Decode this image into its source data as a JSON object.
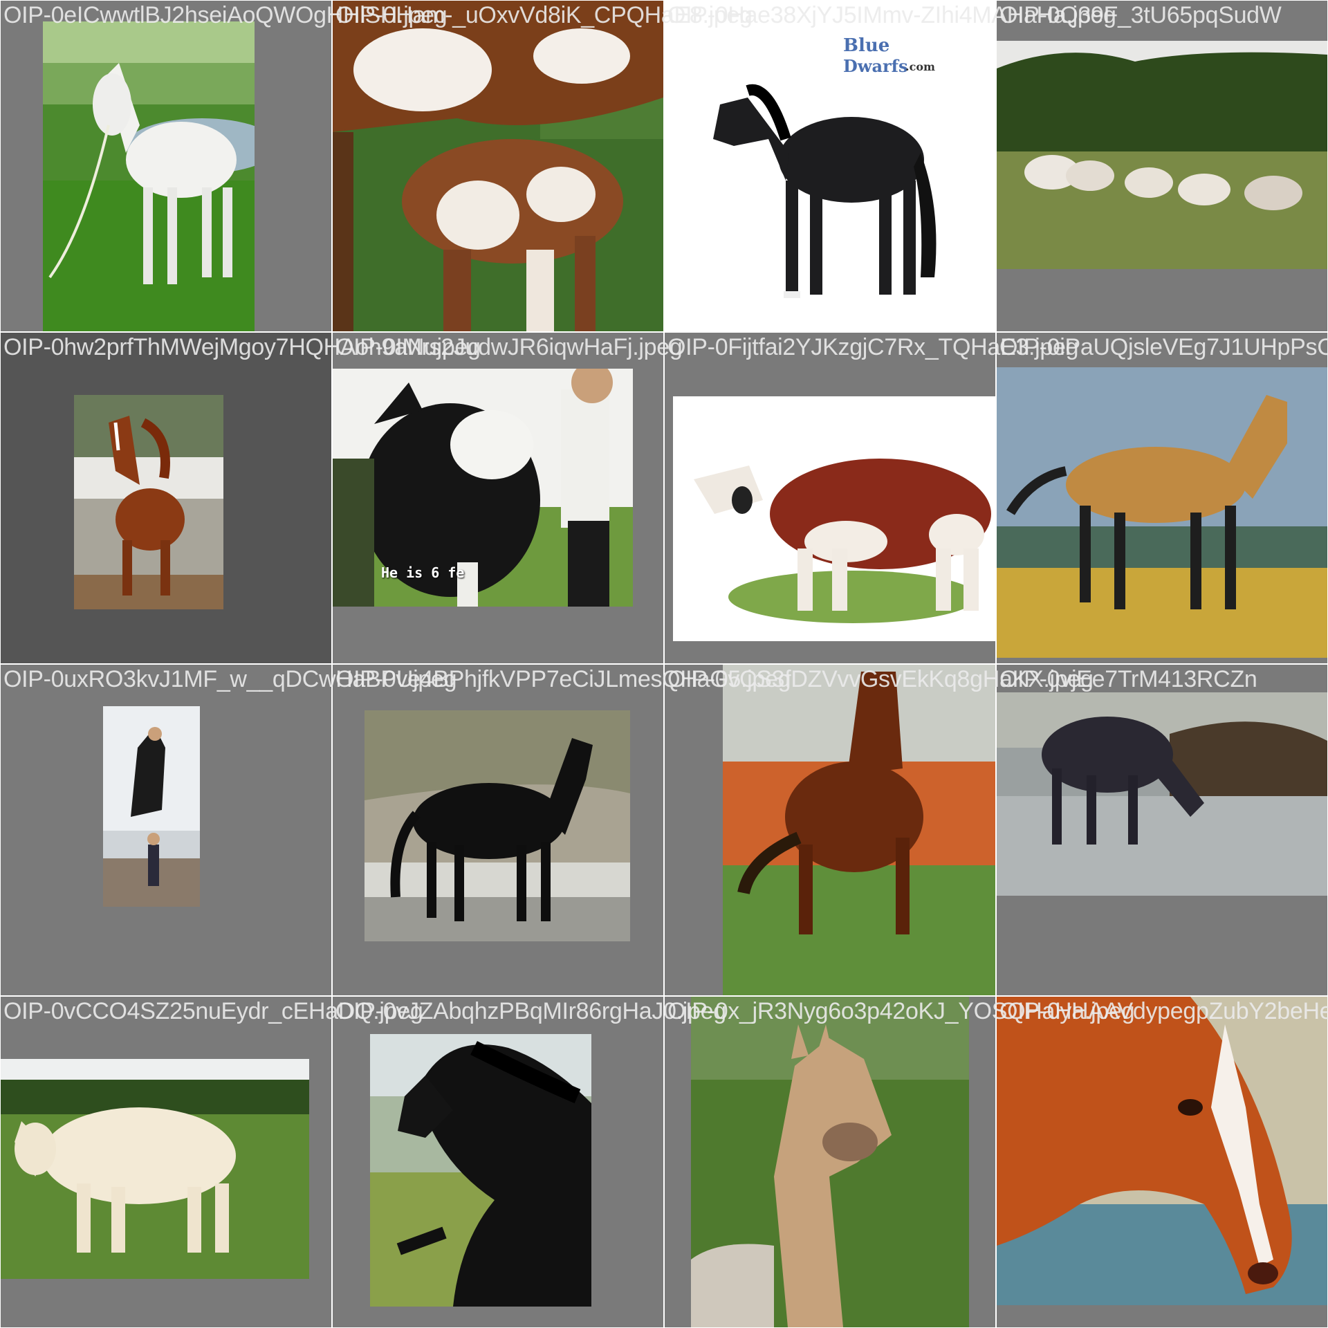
{
  "captions": [
    "OIP-0eICwwtlBJ2hseiAoQWOgHHlSH.jpeg",
    "OIP-0Ham-_uOxvVd8iK_CPQHaE8.jpeg",
    "OIP-0Hae38XjYJ5IMmv-ZIhi4MAHaHa.jpeg",
    "OIP-0Q39F_3tU65pqSudW",
    "OIP-0hw2prfThMWejMgoy7HQHAoh9aNujpeg",
    "OIP-0IMrs2JudwJR6iqwHaFj.jpeg",
    "OIP-0Fijtfai2YJKzgjC7Rx_TQHaE3.jpeg",
    "OIP-0iPaUQjsleVEg7J1UHpPsC",
    "OIP-0uxRO3kvJ1MF_w__qDCwHaBPUjpeg",
    "OIP-0ve4BPhjfkVPP7eCiJLmesQHaG5.jpeg",
    "OIP-0vCS3fDZVvvGsvEkKq8gHaKX.jpeg",
    "OIP-0vjEe7TrM413RCZn",
    "OIP-0vCCO4SZ25nuEydr_cEHaDQ.jpeg",
    "OIP-0vJZAbqhzPBqMIr86rgHaJ0.jpeg",
    "OIP-0x_jR3Nyg6o3p42oKJ_YOSQHaHa.jpeg",
    "OIP-0yHAAVdypegpZubY2beHe"
  ],
  "overlays": {
    "cow_video_caption": "He is 6 fe",
    "logo_blue": "Blue",
    "logo_dwarfs": "Dwarfs",
    "logo_com": ".com"
  },
  "colors": {
    "cell_background": "#7a7a7a",
    "cell_background_dark": "#555555",
    "caption_text": "#ebebeb"
  },
  "cells": [
    {
      "subject": "white-horse-by-river"
    },
    {
      "subject": "brown-white-cow-with-calf"
    },
    {
      "subject": "black-horse-figurine"
    },
    {
      "subject": "white-cattle-herd-in-field"
    },
    {
      "subject": "chestnut-horse-trotting"
    },
    {
      "subject": "black-white-cow-with-people"
    },
    {
      "subject": "brown-white-cow-with-bell"
    },
    {
      "subject": "buckskin-horse-walking"
    },
    {
      "subject": "rider-on-rearing-horse"
    },
    {
      "subject": "black-horse-standing"
    },
    {
      "subject": "bay-horse-rearing"
    },
    {
      "subject": "dark-horse-grazing-in-mud"
    },
    {
      "subject": "white-cow-in-field"
    },
    {
      "subject": "black-friesian-horse-running"
    },
    {
      "subject": "buckskin-horse-portrait"
    },
    {
      "subject": "chestnut-arabian-head"
    }
  ]
}
